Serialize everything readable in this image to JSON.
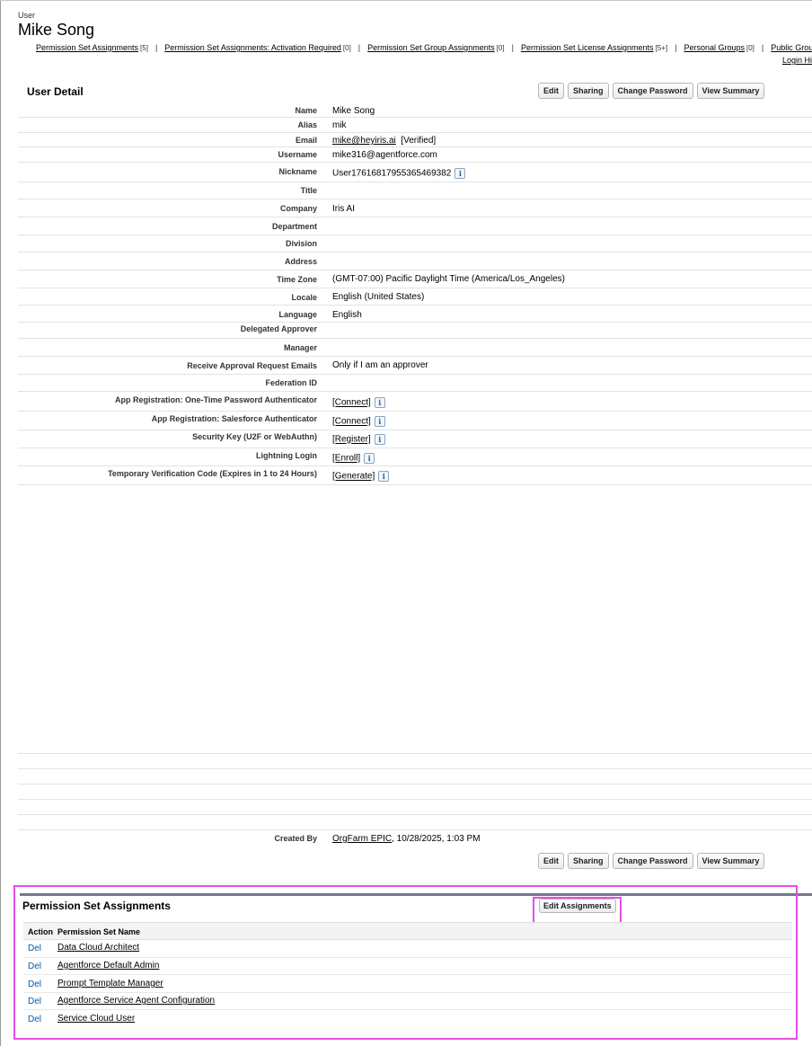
{
  "header": {
    "object_type": "User",
    "title": "Mike Song"
  },
  "related_links": [
    {
      "label": "Permission Set Assignments",
      "count": "[5]"
    },
    {
      "label": "Permission Set Assignments: Activation Required",
      "count": "[0]"
    },
    {
      "label": "Permission Set Group Assignments",
      "count": "[0]"
    },
    {
      "label": "Permission Set License Assignments",
      "count": "[5+]"
    },
    {
      "label": "Personal Groups",
      "count": "[0]"
    },
    {
      "label": "Public Group Me",
      "count": ""
    }
  ],
  "related_links_row2": "Login Hi",
  "user_detail": {
    "title": "User Detail",
    "buttons": {
      "edit": "Edit",
      "sharing": "Sharing",
      "change_password": "Change Password",
      "view_summary": "View Summary"
    },
    "fields": {
      "name": {
        "label": "Name",
        "value": "Mike Song"
      },
      "alias": {
        "label": "Alias",
        "value": "mik"
      },
      "email": {
        "label": "Email",
        "value": "mike@heyiris.ai",
        "suffix": "[Verified]"
      },
      "username": {
        "label": "Username",
        "value": "mike316@agentforce.com"
      },
      "nickname": {
        "label": "Nickname",
        "value": "User17616817955365469382"
      },
      "title": {
        "label": "Title",
        "value": ""
      },
      "company": {
        "label": "Company",
        "value": "Iris AI"
      },
      "department": {
        "label": "Department",
        "value": ""
      },
      "division": {
        "label": "Division",
        "value": ""
      },
      "address": {
        "label": "Address",
        "value": ""
      },
      "time_zone": {
        "label": "Time Zone",
        "value": "(GMT-07:00) Pacific Daylight Time (America/Los_Angeles)"
      },
      "locale": {
        "label": "Locale",
        "value": "English (United States)"
      },
      "language": {
        "label": "Language",
        "value": "English"
      },
      "delegated_approver": {
        "label": "Delegated Approver",
        "value": ""
      },
      "manager": {
        "label": "Manager",
        "value": ""
      },
      "receive_approval": {
        "label": "Receive Approval Request Emails",
        "value": "Only if I am an approver"
      },
      "federation_id": {
        "label": "Federation ID",
        "value": ""
      },
      "otp_auth": {
        "label": "App Registration: One-Time Password Authenticator",
        "value": "[Connect]"
      },
      "sf_auth": {
        "label": "App Registration: Salesforce Authenticator",
        "value": "[Connect]"
      },
      "security_key": {
        "label": "Security Key (U2F or WebAuthn)",
        "value": "[Register]"
      },
      "lightning_login": {
        "label": "Lightning Login",
        "value": "[Enroll]"
      },
      "temp_code": {
        "label": "Temporary Verification Code (Expires in 1 to 24 Hours)",
        "value": "[Generate]"
      },
      "created_by": {
        "label": "Created By",
        "value": "OrgFarm EPIC",
        "suffix": ", 10/28/2025, 1:03 PM"
      }
    }
  },
  "psa": {
    "title": "Permission Set Assignments",
    "edit_button": "Edit Assignments",
    "col_action": "Action",
    "col_name": "Permission Set Name",
    "del_label": "Del",
    "rows": [
      "Data Cloud Architect",
      "Agentforce Default Admin",
      "Prompt Template Manager",
      "Agentforce Service Agent Configuration",
      "Service Cloud User"
    ]
  },
  "colors": {
    "highlight": "#e54ee8",
    "link_blue": "#015ba7",
    "section_border": "#707a86"
  },
  "icons": {
    "info": "info-icon"
  }
}
